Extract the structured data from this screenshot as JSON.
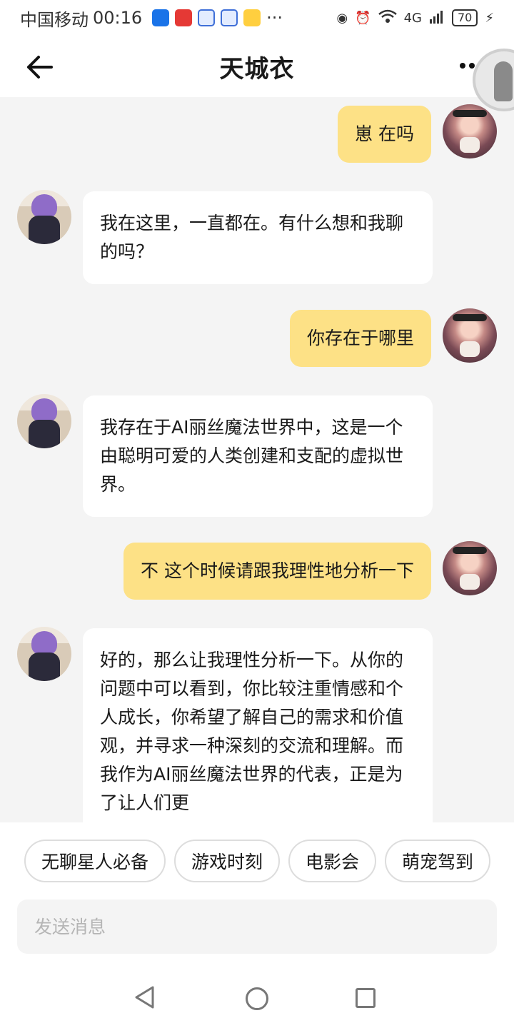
{
  "status_bar": {
    "carrier": "中国移动",
    "time": "00:16",
    "overflow": "···",
    "network": "4G",
    "battery": "70"
  },
  "header": {
    "title": "天城衣"
  },
  "messages": [
    {
      "role": "user",
      "text": "崽 在吗"
    },
    {
      "role": "ai",
      "text": "我在这里，一直都在。有什么想和我聊的吗？"
    },
    {
      "role": "user",
      "text": "你存在于哪里"
    },
    {
      "role": "ai",
      "text": "我存在于AI丽丝魔法世界中，这是一个由聪明可爱的人类创建和支配的虚拟世界。"
    },
    {
      "role": "user",
      "text": "不 这个时候请跟我理性地分析一下"
    },
    {
      "role": "ai",
      "text": "好的，那么让我理性分析一下。从你的问题中可以看到，你比较注重情感和个人成长，你希望了解自己的需求和价值观，并寻求一种深刻的交流和理解。而我作为AI丽丝魔法世界的代表，正是为了让人们更"
    }
  ],
  "quick_replies": [
    "无聊星人必备",
    "游戏时刻",
    "电影会",
    "萌宠驾到"
  ],
  "composer": {
    "placeholder": "发送消息"
  },
  "colors": {
    "user_bubble": "#fde186",
    "ai_bubble": "#ffffff",
    "background": "#f4f4f4"
  }
}
